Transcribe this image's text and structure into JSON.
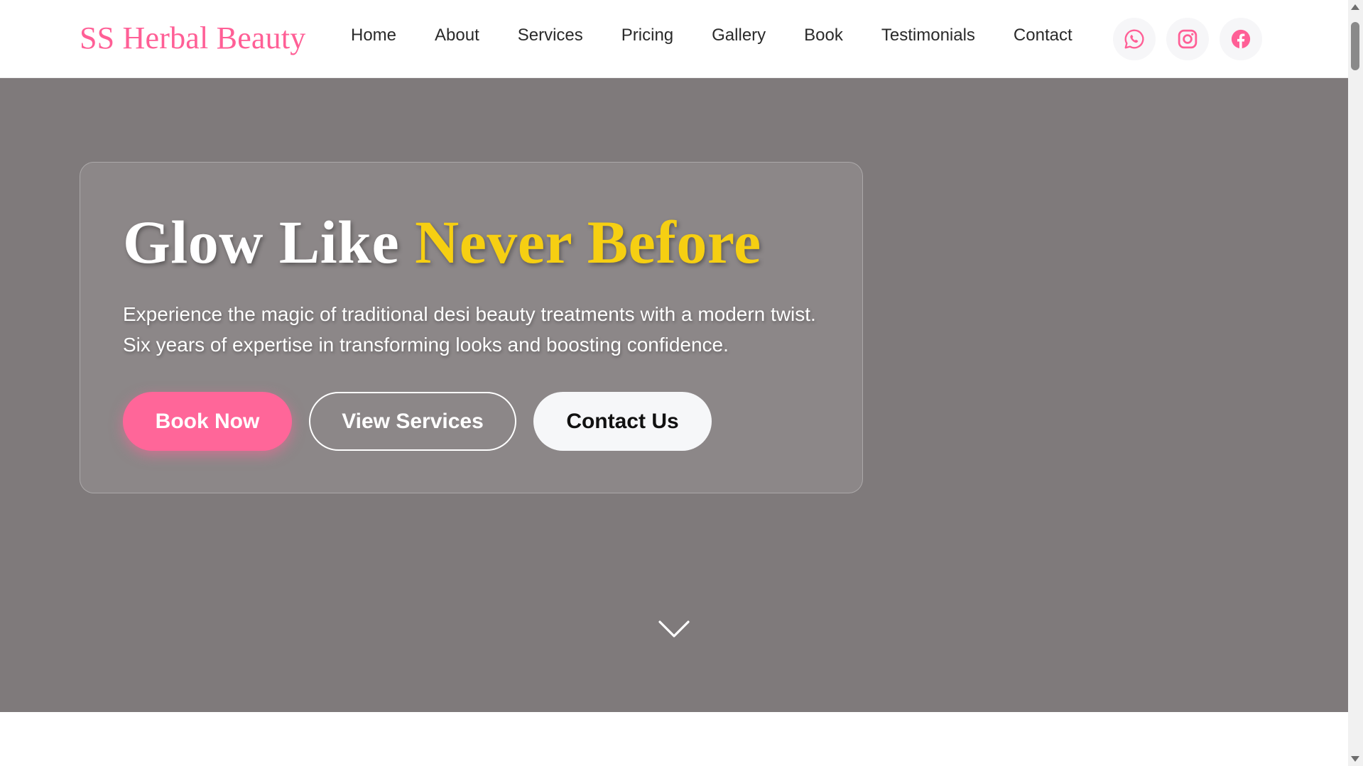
{
  "brand": {
    "name": "SS Herbal Beauty",
    "color": "#ff5f96"
  },
  "nav": {
    "items": [
      "Home",
      "About",
      "Services",
      "Pricing",
      "Gallery",
      "Book",
      "Testimonials",
      "Contact"
    ]
  },
  "social": [
    {
      "icon": "whatsapp-icon"
    },
    {
      "icon": "instagram-icon"
    },
    {
      "icon": "facebook-icon"
    }
  ],
  "hero": {
    "title_plain": "Glow Like ",
    "title_highlight": "Never Before",
    "subtitle": "Experience the magic of traditional desi beauty treatments with a modern twist. Six years of expertise in transforming looks and boosting confidence.",
    "buttons": {
      "book": "Book Now",
      "services": "View Services",
      "contact": "Contact Us"
    },
    "scroll_icon": "chevron-down-icon"
  },
  "colors": {
    "accent": "#ff6699",
    "highlight": "#f6cf12",
    "hero_bg": "#7f7a7b"
  }
}
